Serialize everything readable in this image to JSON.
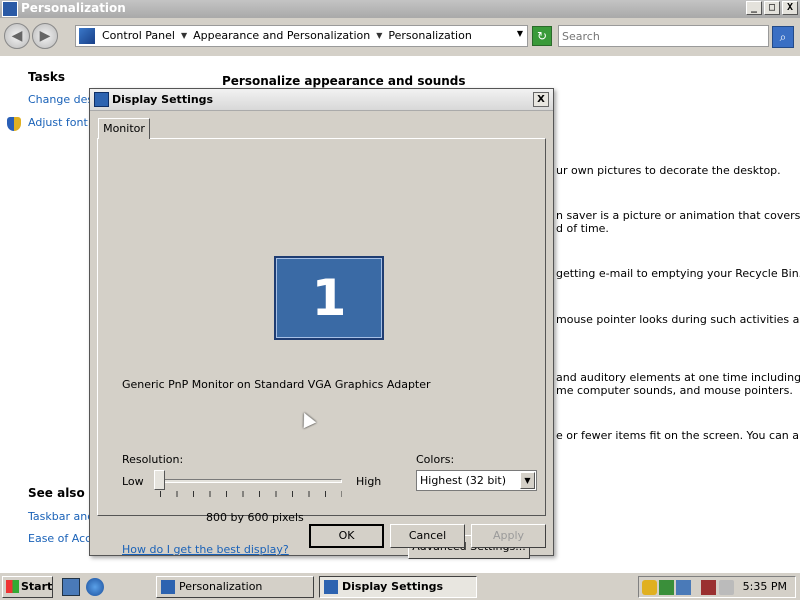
{
  "window": {
    "title": "Personalization",
    "controls": {
      "minimize": "_",
      "maximize": "□",
      "close": "X"
    }
  },
  "address_bar": {
    "crumbs": [
      "Control Panel",
      "Appearance and Personalization",
      "Personalization"
    ],
    "search_placeholder": "Search"
  },
  "sidebar": {
    "tasks_title": "Tasks",
    "task_links": [
      "Change desk",
      "Adjust font s"
    ],
    "see_also_title": "See also",
    "see_also_links": [
      "Taskbar and",
      "Ease of Acce"
    ]
  },
  "main": {
    "heading": "Personalize appearance and sounds",
    "background_lines": [
      "ur own pictures to decorate the desktop.",
      "n saver is a picture or animation that covers your",
      "d of time.",
      "getting e-mail to emptying your Recycle Bin.",
      "mouse pointer looks during such activities as",
      "and auditory elements at one time including the",
      "me computer sounds, and mouse pointers.",
      "e or fewer items fit on the screen. You can also"
    ]
  },
  "dialog": {
    "title": "Display Settings",
    "close": "X",
    "tab": "Monitor",
    "monitor_number": "1",
    "monitor_description": "Generic PnP Monitor on Standard VGA Graphics Adapter",
    "resolution": {
      "label": "Resolution:",
      "low": "Low",
      "high": "High",
      "value_text": "800 by 600 pixels",
      "slider_level": 0
    },
    "colors": {
      "label": "Colors:",
      "selected": "Highest (32 bit)"
    },
    "help_link": "How do I get the best display?",
    "buttons": {
      "advanced": "Advanced Settings...",
      "ok": "OK",
      "cancel": "Cancel",
      "apply": "Apply"
    }
  },
  "taskbar": {
    "start": "Start",
    "tasks": [
      {
        "label": "Personalization",
        "active": false
      },
      {
        "label": "Display Settings",
        "active": true
      }
    ],
    "clock": "5:35 PM"
  }
}
